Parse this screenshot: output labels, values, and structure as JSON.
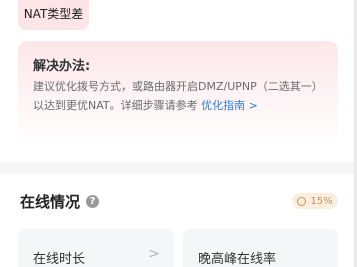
{
  "nat_tag": {
    "label": "NAT类型差"
  },
  "solution": {
    "title": "解决办法:",
    "body": "建议优化拨号方式，或路由器开启DMZ/UPNP（二选其一）以达到更优NAT。详细步骤请参考 ",
    "link_label": "优化指南 >"
  },
  "online": {
    "title": "在线情况",
    "help_icon": "question-icon",
    "badge_value": "15%"
  },
  "cards": [
    {
      "label": "在线时长",
      "chevron": ">"
    },
    {
      "label": "晚高峰在线率"
    }
  ]
}
